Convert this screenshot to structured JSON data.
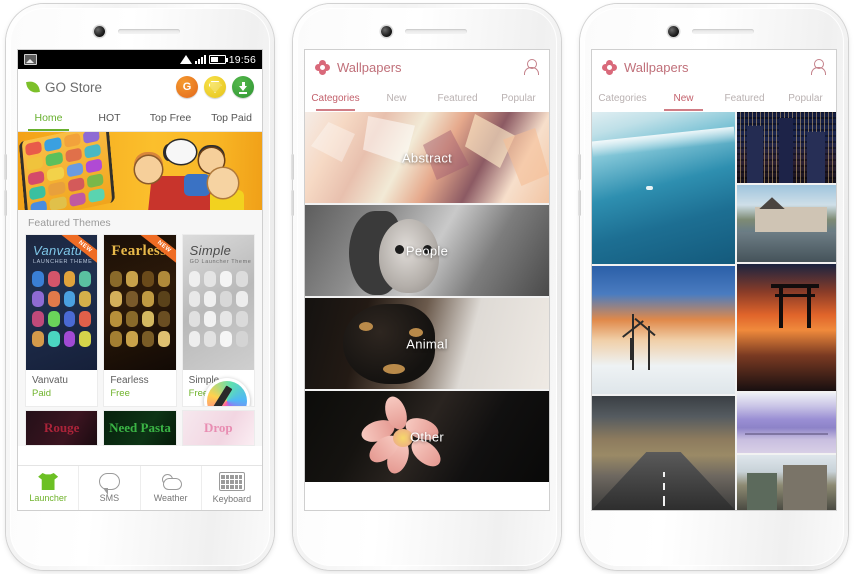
{
  "phone1": {
    "statusbar": {
      "time": "19:56",
      "icons": [
        "photo-icon",
        "wifi-icon",
        "signal-icon",
        "battery-icon"
      ]
    },
    "appbar": {
      "title": "GO Store",
      "logo": "leaf-icon",
      "actions": [
        {
          "name": "coins-button",
          "glyph": "G"
        },
        {
          "name": "gem-button",
          "glyph": ""
        },
        {
          "name": "downloads-button",
          "glyph": ""
        }
      ]
    },
    "tabs": [
      {
        "label": "Home",
        "active": true
      },
      {
        "label": "HOT",
        "active": false
      },
      {
        "label": "Top Free",
        "active": false
      },
      {
        "label": "Top Paid",
        "active": false
      }
    ],
    "section_title": "Featured Themes",
    "themes": [
      {
        "name": "Vanvatu",
        "price": "Paid",
        "badge": "NEW",
        "art_title": "Vanvatu",
        "art_sub": "LAUNCHER THEME"
      },
      {
        "name": "Fearless",
        "price": "Free",
        "badge": "NEW",
        "art_title": "Fearless",
        "art_sub": ""
      },
      {
        "name": "Simple",
        "price": "Free",
        "badge": "",
        "art_title": "Simple",
        "art_sub": "GO Launcher Theme"
      }
    ],
    "themes_row2": [
      {
        "name": "Rouge"
      },
      {
        "name": "Need Pasta"
      },
      {
        "name": "Drop"
      }
    ],
    "bottom_nav": [
      {
        "label": "Launcher",
        "icon": "shirt-icon",
        "active": true
      },
      {
        "label": "SMS",
        "icon": "message-icon",
        "active": false
      },
      {
        "label": "Weather",
        "icon": "weather-icon",
        "active": false
      },
      {
        "label": "Keyboard",
        "icon": "keyboard-icon",
        "active": false
      }
    ]
  },
  "phone2": {
    "appbar": {
      "title": "Wallpapers",
      "logo": "flower-icon",
      "account": "person-icon"
    },
    "tabs": [
      {
        "label": "Categories",
        "active": true
      },
      {
        "label": "New",
        "active": false
      },
      {
        "label": "Featured",
        "active": false
      },
      {
        "label": "Popular",
        "active": false
      }
    ],
    "categories": [
      {
        "label": "Abstract"
      },
      {
        "label": "People"
      },
      {
        "label": "Animal"
      },
      {
        "label": "Other"
      }
    ]
  },
  "phone3": {
    "appbar": {
      "title": "Wallpapers",
      "logo": "flower-icon",
      "account": "person-icon"
    },
    "tabs": [
      {
        "label": "Categories",
        "active": false
      },
      {
        "label": "New",
        "active": true
      },
      {
        "label": "Featured",
        "active": false
      },
      {
        "label": "Popular",
        "active": false
      }
    ],
    "wallpapers": [
      {
        "name": "ocean-wave-wallpaper"
      },
      {
        "name": "city-skyline-night-wallpaper"
      },
      {
        "name": "castle-reflection-wallpaper"
      },
      {
        "name": "wind-turbines-wallpaper"
      },
      {
        "name": "torii-gate-sunset-wallpaper"
      },
      {
        "name": "mountain-road-wallpaper"
      },
      {
        "name": "purple-bridge-wallpaper"
      },
      {
        "name": "modern-building-wallpaper"
      }
    ]
  },
  "colors": {
    "go_green": "#6fb32b",
    "wallpaper_accent": "#c3616c",
    "banner_orange": "#f6ad20",
    "status_bar": "#000000"
  }
}
